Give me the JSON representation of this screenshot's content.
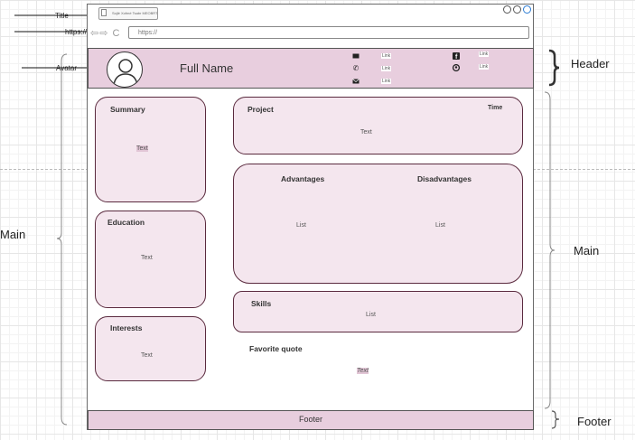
{
  "annotations": {
    "title": "Title",
    "https": "https://",
    "avatar": "Avatar",
    "header": "Header",
    "main_left": "Main",
    "main_right": "Main",
    "footer": "Footer"
  },
  "browser": {
    "tab_title": "Sojlé Xofmé Tsabr MEOBRT",
    "nav_glyphs": "⇦⇨ C",
    "url": "https://"
  },
  "header": {
    "full_name": "Full Name",
    "contacts": [
      {
        "icon": "email-icon",
        "link": "Link"
      },
      {
        "icon": "phone-icon",
        "link": "Link"
      },
      {
        "icon": "mail-icon",
        "link": "Link"
      },
      {
        "icon": "facebook-icon",
        "link": "Link"
      },
      {
        "icon": "github-icon",
        "link": "Link"
      }
    ]
  },
  "summary": {
    "title": "Summary",
    "text": "Text"
  },
  "education": {
    "title": "Education",
    "text": "Text"
  },
  "interests": {
    "title": "Interests",
    "text": "Text"
  },
  "project": {
    "title": "Project",
    "time": "Time",
    "text": "Text"
  },
  "advantages": {
    "title": "Advantages",
    "list": "List"
  },
  "disadvantages": {
    "title": "Disadvantages",
    "list": "List"
  },
  "skills": {
    "title": "Skills",
    "list": "List"
  },
  "quote": {
    "title": "Favorite quote",
    "text": "Text"
  },
  "footer": {
    "label": "Footer"
  },
  "colors": {
    "header_fill": "#e8cede",
    "panel_fill": "#f4e6ee",
    "panel_border": "#5a2a3e"
  }
}
